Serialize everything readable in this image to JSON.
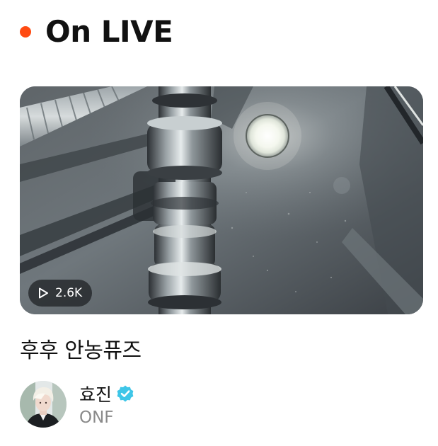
{
  "section": {
    "title": "On LIVE",
    "live_dot_color": "#ff4b12"
  },
  "live": {
    "view_count": "2.6K",
    "view_icon": "play-outline-icon",
    "title": "후후 안농퓨즈",
    "artist": {
      "name": "효진",
      "verified": true,
      "verified_icon": "verified-badge-icon",
      "verified_color": "#3ec6e8",
      "group": "ONF"
    }
  }
}
